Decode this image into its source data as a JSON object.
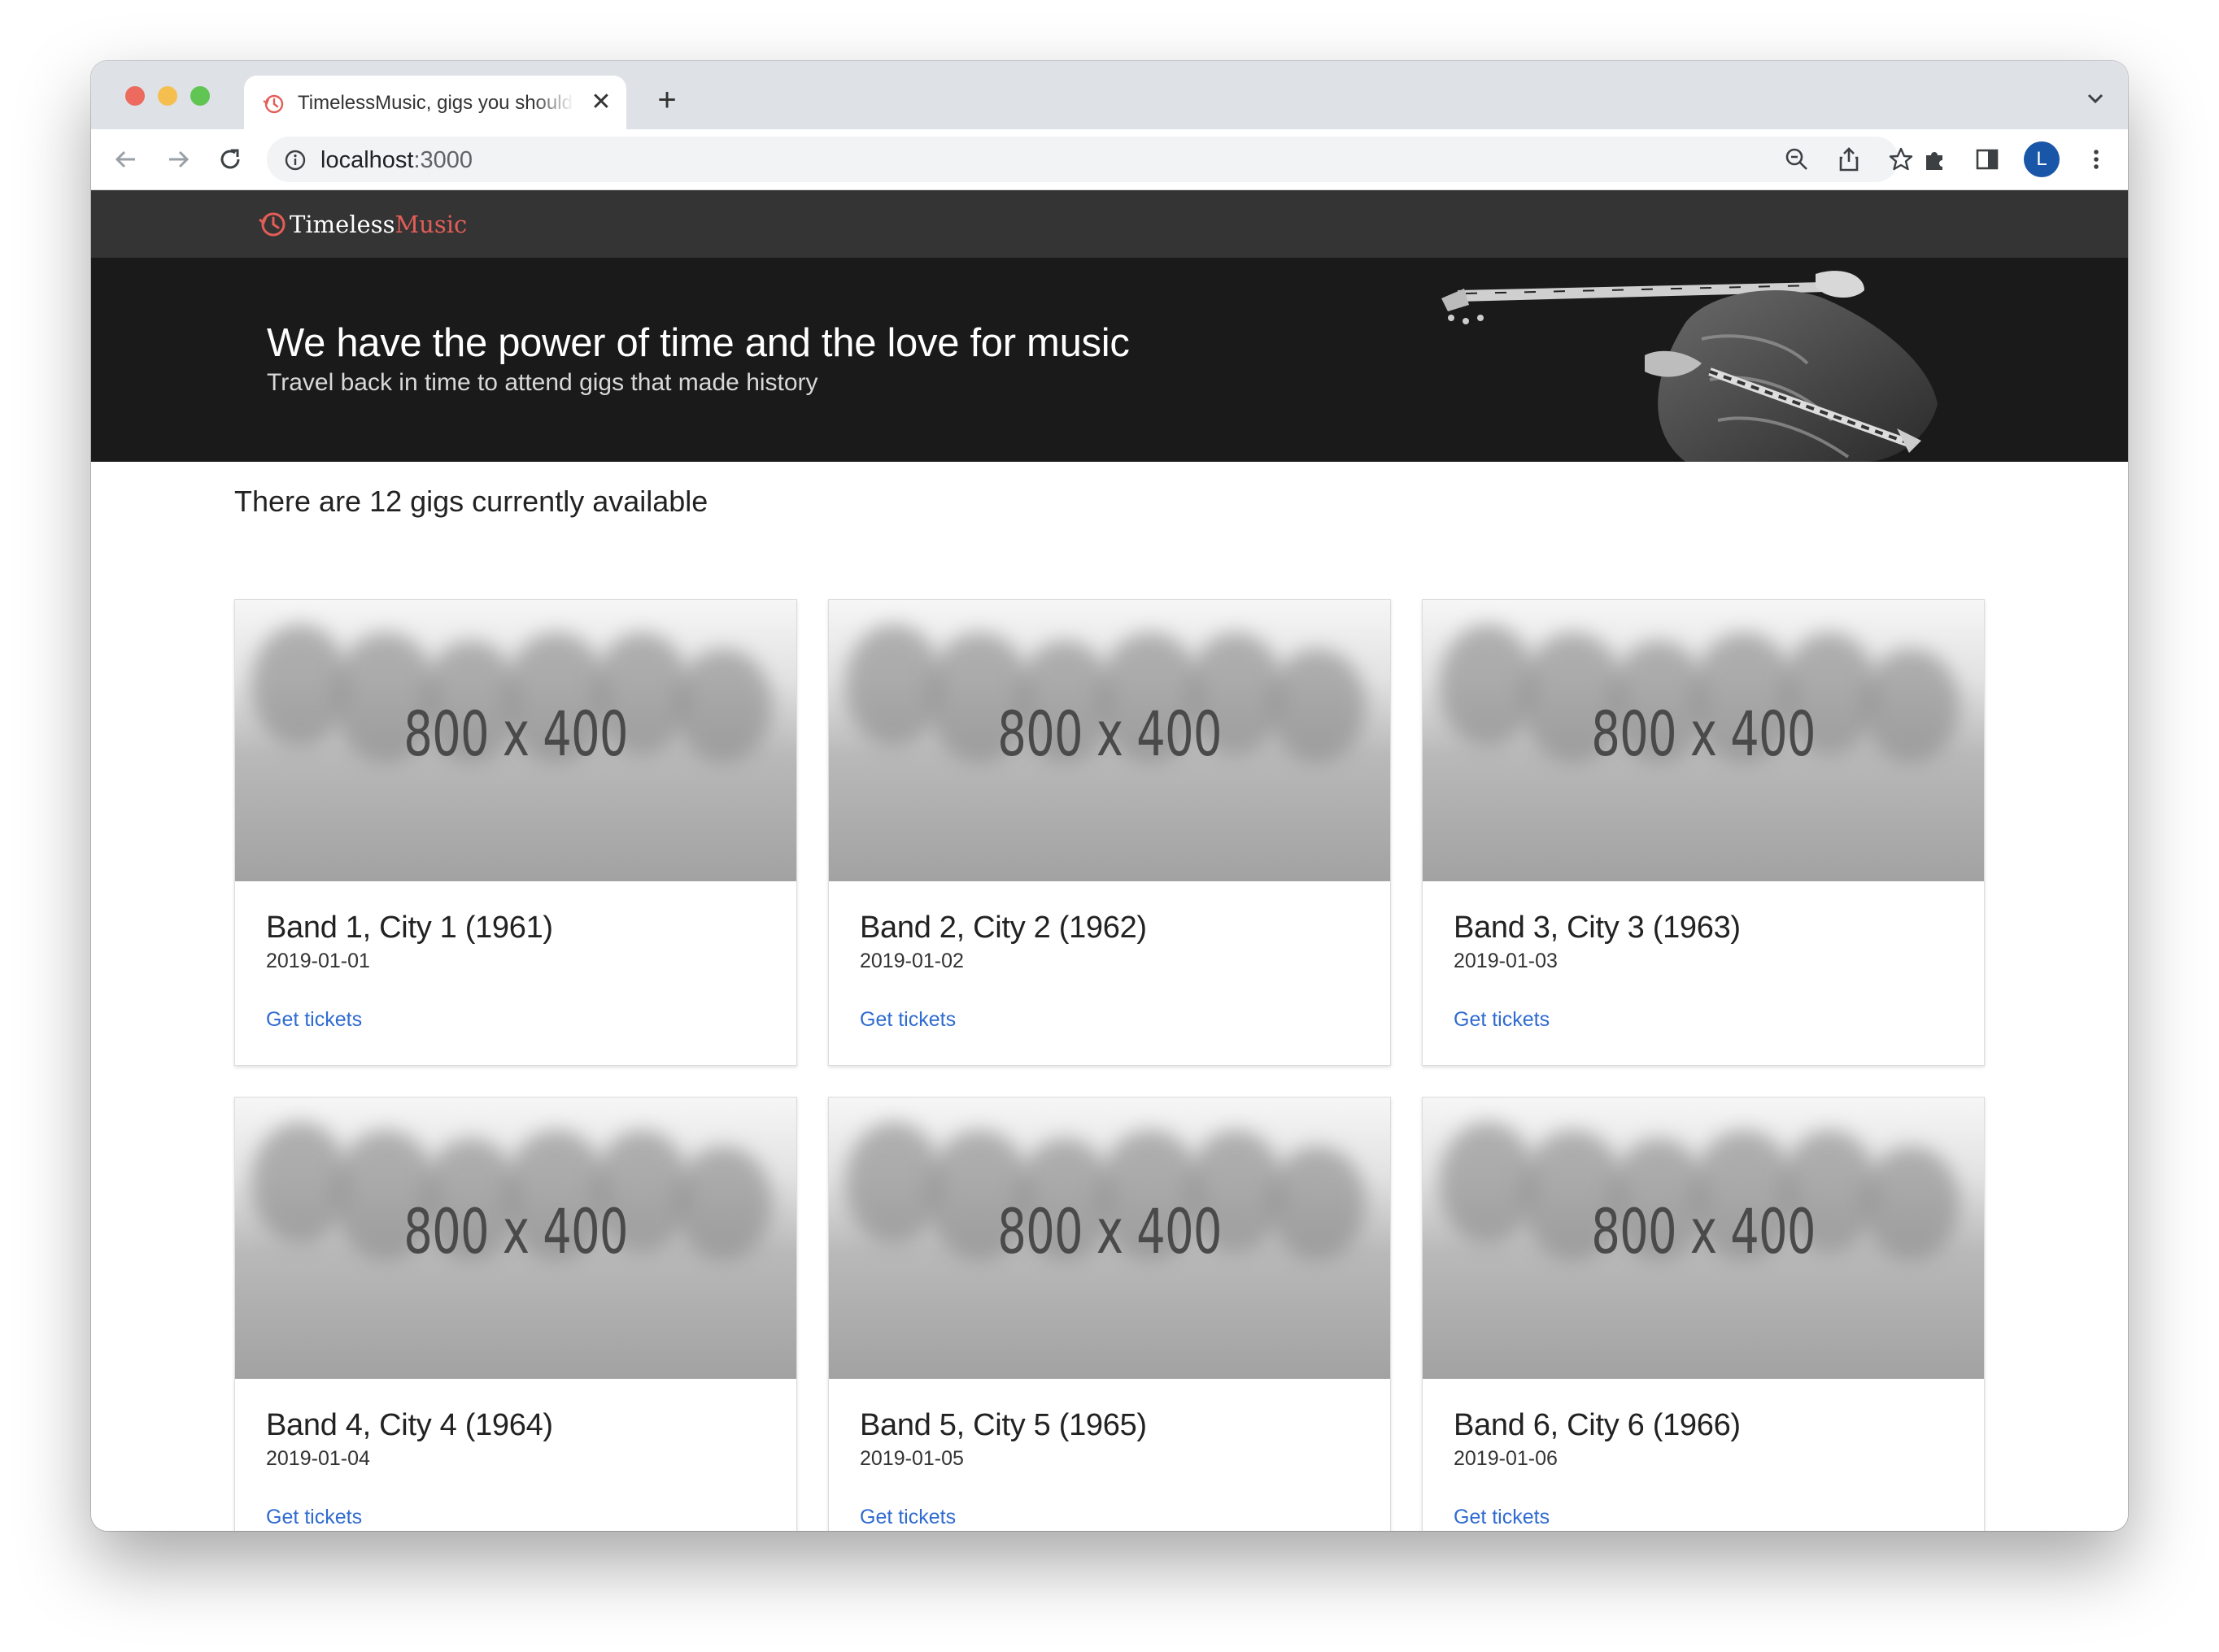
{
  "browser": {
    "tab_title": "TimelessMusic, gigs you should",
    "url_host": "localhost",
    "url_port": ":3000",
    "profile_initial": "L"
  },
  "site": {
    "brand_part1": "Timeless",
    "brand_part2": "Music",
    "brand_color": "#e35d57",
    "hero_title": "We have the power of time and the love for music",
    "hero_subtitle": "Travel back in time to attend gigs that made history",
    "count_text": "There are 12 gigs currently available"
  },
  "gigs": [
    {
      "image_label": "800 x 400",
      "title": "Band 1, City 1 (1961)",
      "date": "2019-01-01",
      "link": "Get tickets"
    },
    {
      "image_label": "800 x 400",
      "title": "Band 2, City 2 (1962)",
      "date": "2019-01-02",
      "link": "Get tickets"
    },
    {
      "image_label": "800 x 400",
      "title": "Band 3, City 3 (1963)",
      "date": "2019-01-03",
      "link": "Get tickets"
    },
    {
      "image_label": "800 x 400",
      "title": "Band 4, City 4 (1964)",
      "date": "2019-01-04",
      "link": "Get tickets"
    },
    {
      "image_label": "800 x 400",
      "title": "Band 5, City 5 (1965)",
      "date": "2019-01-05",
      "link": "Get tickets"
    },
    {
      "image_label": "800 x 400",
      "title": "Band 6, City 6 (1966)",
      "date": "2019-01-06",
      "link": "Get tickets"
    }
  ],
  "colors": {
    "link": "#2f6bd0",
    "navbar": "#343434",
    "hero": "#1a1a1a"
  }
}
